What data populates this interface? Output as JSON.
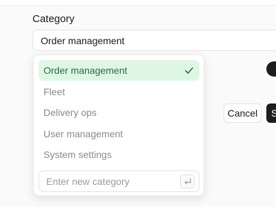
{
  "form": {
    "category_label": "Category",
    "category_value": "Order management"
  },
  "dropdown": {
    "options": [
      {
        "label": "Order management",
        "selected": true
      },
      {
        "label": "Fleet",
        "selected": false
      },
      {
        "label": "Delivery ops",
        "selected": false
      },
      {
        "label": "User management",
        "selected": false
      },
      {
        "label": "System settings",
        "selected": false
      }
    ],
    "new_category_placeholder": "Enter new category",
    "selected_icon": "check-icon",
    "submit_icon": "enter-key-icon"
  },
  "actions": {
    "cancel_label": "Cancel",
    "save_label": "S"
  },
  "colors": {
    "selected_bg": "#ddf7e3",
    "selected_text": "#2a6b45",
    "primary_button": "#1d1d1f"
  }
}
